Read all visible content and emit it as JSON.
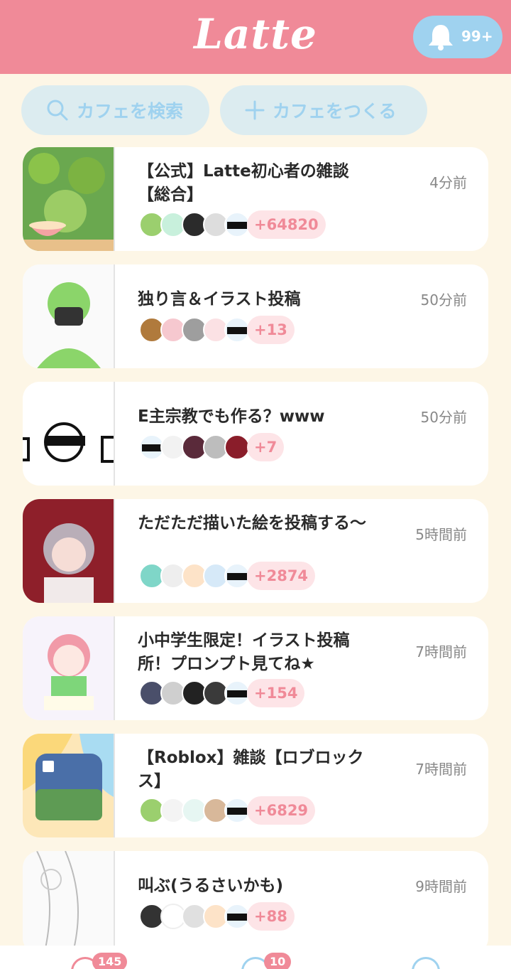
{
  "header": {
    "logo": "Latte",
    "notification_count": "99+",
    "colors": {
      "header_bg": "#f08a98",
      "accent_blue": "#9fd2ef",
      "badge_bg": "#fde4e7"
    }
  },
  "actions": {
    "search_label": "カフェを検索",
    "create_label": "カフェをつくる"
  },
  "cafes": [
    {
      "title": "【公式】Latte初心者の雑談【総合】",
      "time": "4分前",
      "more": "+64820"
    },
    {
      "title": "独り言＆イラスト投稿",
      "time": "50分前",
      "more": "+13"
    },
    {
      "title": "E主宗教でも作る？www",
      "time": "50分前",
      "more": "+7"
    },
    {
      "title": "ただただ描いた絵を投稿する〜",
      "time": "5時間前",
      "more": "+2874"
    },
    {
      "title": "小中学生限定！イラスト投稿所！プロンプト見てね★",
      "time": "7時間前",
      "more": "+154"
    },
    {
      "title": "【Roblox】雑談【ロブロックス】",
      "time": "7時間前",
      "more": "+6829"
    },
    {
      "title": "叫ぶ(うるさいかも)",
      "time": "9時間前",
      "more": "+88"
    }
  ],
  "tabbar": {
    "badges": [
      "145",
      "10"
    ]
  }
}
